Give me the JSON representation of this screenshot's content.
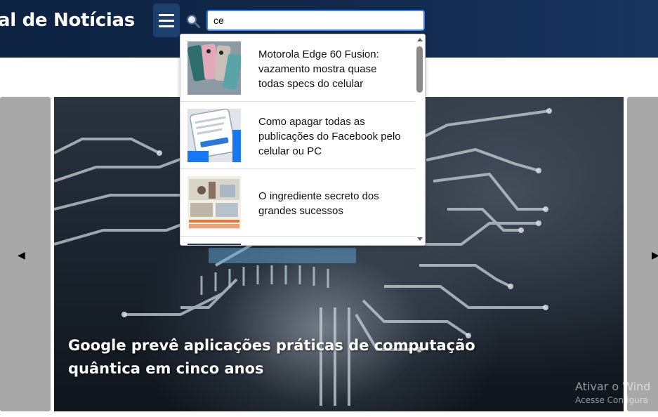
{
  "header": {
    "site_title": "al de Notícias",
    "menu_icon": "hamburger-icon",
    "search_icon": "magnifier-icon",
    "search_value": "ce"
  },
  "search_results": [
    {
      "title": "Motorola Edge 60 Fusion: vazamento mostra quase todas specs do celular",
      "thumb_icon": "phones-thumbnail"
    },
    {
      "title": "Como apagar todas as publicações do Facebook pelo celular ou PC",
      "thumb_icon": "facebook-screen-thumbnail"
    },
    {
      "title": "O ingrediente secreto dos grandes sucessos",
      "thumb_icon": "poster-thumbnail"
    }
  ],
  "carousel": {
    "prev_icon": "chevron-left-icon",
    "next_icon": "chevron-right-icon",
    "slide_title": "Google prevê aplicações práticas de computação quântica em cinco anos"
  },
  "watermark": {
    "line1": "Ativar o Wind",
    "line2": "Acesse Configura"
  },
  "colors": {
    "header_bg": "#122a4e",
    "accent": "#3a82e4"
  }
}
